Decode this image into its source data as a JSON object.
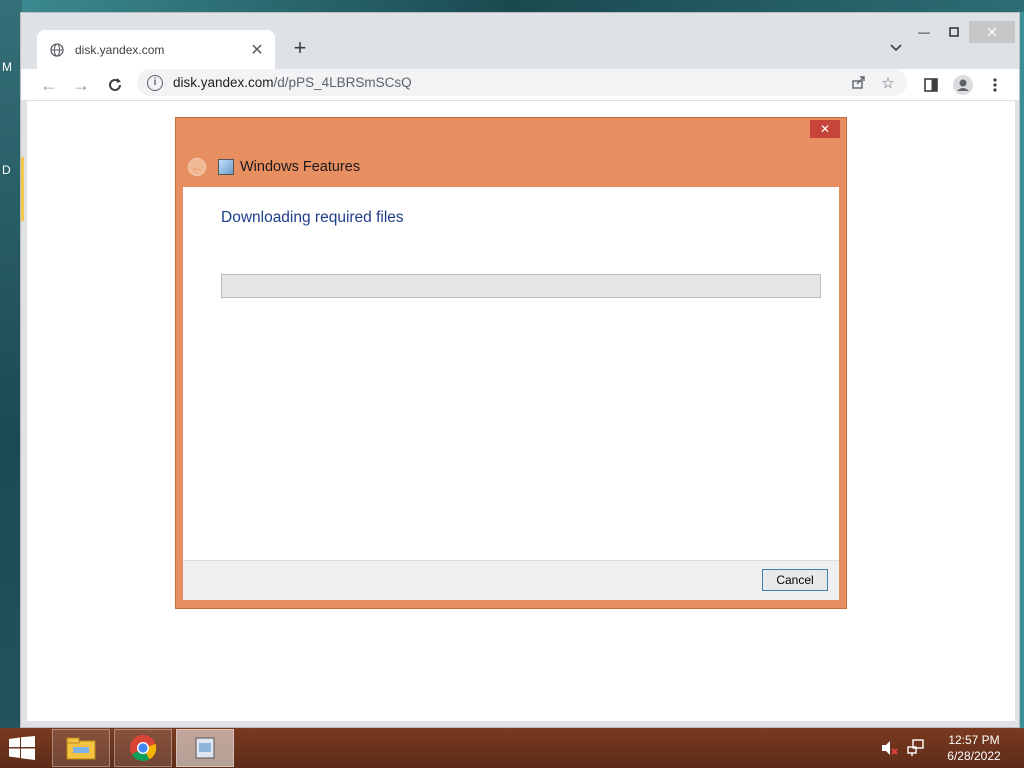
{
  "browser": {
    "tab_title": "disk.yandex.com",
    "url_host": "disk.yandex.com",
    "url_path": "/d/pPS_4LBRSmSCsQ"
  },
  "dialog": {
    "title": "Windows Features",
    "heading": "Downloading required files",
    "progress_fraction": 0,
    "cancel_label": "Cancel"
  },
  "taskbar": {
    "time": "12:57 PM",
    "date": "6/28/2022",
    "items": [
      "file-explorer",
      "chrome",
      "windows-features"
    ]
  },
  "desktop": {
    "edge_glyphs": [
      "M",
      "D"
    ]
  },
  "colors": {
    "dialog_accent": "#e88f61",
    "heading_blue": "#1e3f8a",
    "taskbar": "#6b331c"
  }
}
